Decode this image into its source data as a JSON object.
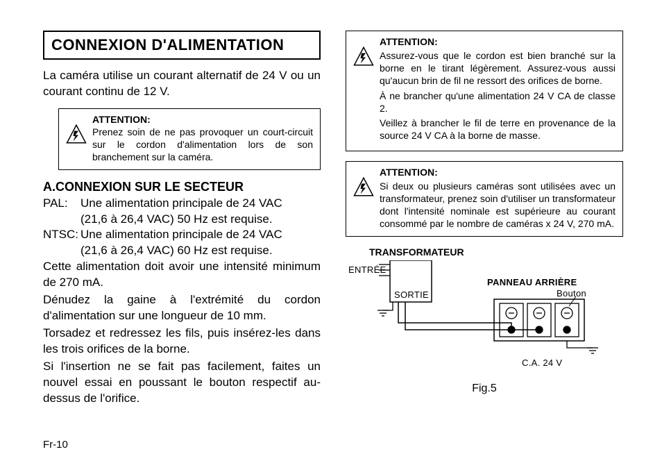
{
  "left": {
    "title": "CONNEXION D'ALIMENTATION",
    "intro": "La caméra utilise un courant alternatif de 24 V ou un courant continu de 12 V.",
    "attention1": {
      "heading": "ATTENTION:",
      "text": "Prenez soin de ne pas provoquer un court-circuit sur le cordon d'alimentation lors de son branchement sur la caméra."
    },
    "sectionA": {
      "title": "A.CONNEXION SUR LE SECTEUR",
      "pal_label": "PAL:",
      "pal_line1": "Une alimentation principale de 24 VAC",
      "pal_line2": "(21,6 à 26,4 VAC) 50 Hz est requise.",
      "ntsc_label": "NTSC:",
      "ntsc_line1": "Une alimentation principale de 24 VAC",
      "ntsc_line2": "(21,6 à 26,4 VAC) 60 Hz est requise.",
      "p1": "Cette alimentation doit avoir une intensité minimum de 270 mA.",
      "p2": "Dénudez la gaine à l'extrémité du cordon d'alimentation sur une longueur de 10 mm.",
      "p3": "Torsadez et redressez les fils, puis insérez-les dans les trois orifices de la borne.",
      "p4": "Si l'insertion ne se fait pas facilement, faites un nouvel essai en poussant le bouton respectif au-dessus de l'orifice."
    }
  },
  "right": {
    "attention2": {
      "heading": "ATTENTION:",
      "line1": "Assurez-vous que le cordon est bien branché sur la borne en le tirant légèrement. Assurez-vous aussi qu'aucun brin de fil ne ressort des orifices de borne.",
      "line2": "À ne brancher qu'une alimentation 24 V CA de classe 2.",
      "line3": "Veillez à brancher le fil de terre en provenance de la source 24 V CA à la borne de masse."
    },
    "attention3": {
      "heading": "ATTENTION:",
      "text": "Si deux ou plusieurs caméras sont utilisées avec un transformateur, prenez soin d'utiliser un transformateur dont l'intensité nominale est supérieure au courant consommé par le nombre de caméras  x 24 V, 270 mA."
    },
    "transformer_title": "TRANSFORMATEUR",
    "diagram": {
      "entree": "ENTRÉE",
      "sortie": "SORTIE",
      "panneau": "PANNEAU ARRIÈRE",
      "bouton": "Bouton",
      "ca24v": "C.A. 24 V"
    },
    "fig_caption": "Fig.5"
  },
  "footer": "Fr-10"
}
